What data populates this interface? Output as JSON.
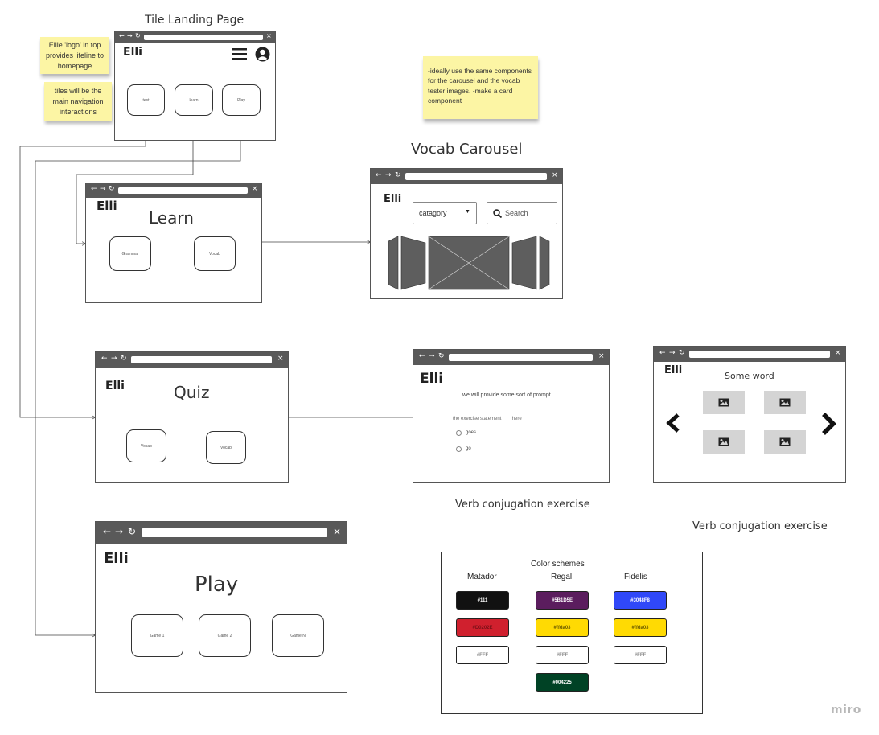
{
  "windows": {
    "landing": {
      "caption": "Tile Landing Page",
      "logo": "Elli",
      "tiles": [
        "test",
        "learn",
        "Play"
      ]
    },
    "learn": {
      "logo": "Elli",
      "title": "Learn",
      "tiles": [
        "Grammar",
        "Vocab"
      ]
    },
    "quiz": {
      "logo": "Elli",
      "title": "Quiz",
      "tiles": [
        "Vocab",
        "Vocab"
      ]
    },
    "play": {
      "logo": "Elli",
      "title": "Play",
      "tiles": [
        "Game 1",
        "Game 2",
        "Game N"
      ]
    },
    "vocab_carousel": {
      "caption": "Vocab Carousel",
      "logo": "Elli",
      "category_label": "catagory",
      "search_placeholder": "Search"
    },
    "exercise": {
      "logo": "Elli",
      "prompt": "we will provide some sort of prompt",
      "statement": "the exercise statement ___ here",
      "options": [
        "goes",
        "go"
      ],
      "caption": "Verb conjugation exercise"
    },
    "word_picker": {
      "logo": "Elli",
      "title": "Some word",
      "caption": "Verb conjugation exercise"
    }
  },
  "stickies": {
    "logo_note": "Ellie 'logo' in top provides lifeline to homepage",
    "tiles_note": "tiles will be the main navigation interactions",
    "components_note": "-ideally use the same components for the carousel and the vocab tester images. -make a card component"
  },
  "color_schemes": {
    "title": "Color schemes",
    "schemes": [
      {
        "name": "Matador",
        "swatches": [
          {
            "label": "#111",
            "color": "#111111",
            "text": "#ffffff"
          },
          {
            "label": "#D0202E",
            "color": "#d0202e",
            "text": "#7a1018"
          },
          {
            "label": "#FFF",
            "color": "#ffffff",
            "text": "#888888"
          }
        ]
      },
      {
        "name": "Regal",
        "swatches": [
          {
            "label": "#5B1D5E",
            "color": "#5b1d5e",
            "text": "#ffffff"
          },
          {
            "label": "#ffda03",
            "color": "#ffda03",
            "text": "#6b5a00"
          },
          {
            "label": "#FFF",
            "color": "#ffffff",
            "text": "#888888"
          },
          {
            "label": "#004225",
            "color": "#004225",
            "text": "#ffffff"
          }
        ]
      },
      {
        "name": "Fidelis",
        "swatches": [
          {
            "label": "#3048F8",
            "color": "#3048f8",
            "text": "#ffffff"
          },
          {
            "label": "#ffda03",
            "color": "#ffda03",
            "text": "#6b5a00"
          },
          {
            "label": "#FFF",
            "color": "#ffffff",
            "text": "#888888"
          }
        ]
      }
    ]
  },
  "brand_watermark": "miro",
  "icons": [
    "back-arrow-icon",
    "forward-arrow-icon",
    "refresh-icon",
    "close-icon",
    "hamburger-menu-icon",
    "user-account-icon",
    "chevron-down-icon",
    "search-icon",
    "image-icon",
    "chevron-left-icon",
    "chevron-right-icon"
  ]
}
